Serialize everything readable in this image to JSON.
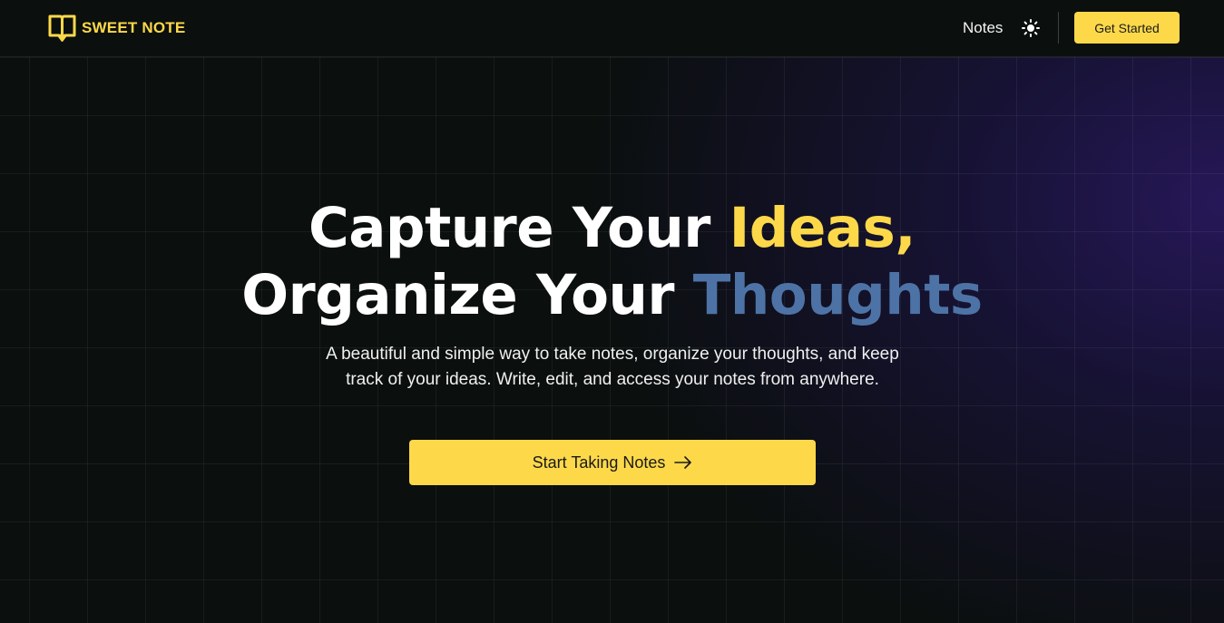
{
  "header": {
    "brand_name": "SWEET NOTE",
    "brand_icon": "open-book-icon",
    "nav_notes_label": "Notes",
    "theme_icon": "sun-icon",
    "get_started_label": "Get Started"
  },
  "hero": {
    "headline_line1_a": "Capture Your ",
    "headline_line1_b": "Ideas,",
    "headline_line2_a": "Organize Your ",
    "headline_line2_b": "Thoughts",
    "subtitle": "A beautiful and simple way to take notes, organize your thoughts, and keep track of your ideas. Write, edit, and access your notes from anywhere.",
    "cta_label": "Start Taking Notes",
    "cta_icon": "arrow-right-icon"
  },
  "colors": {
    "accent_yellow": "#fdd94a",
    "accent_blue": "#4d73a6",
    "background": "#0b0f0e",
    "glow_purple": "#28185c"
  }
}
